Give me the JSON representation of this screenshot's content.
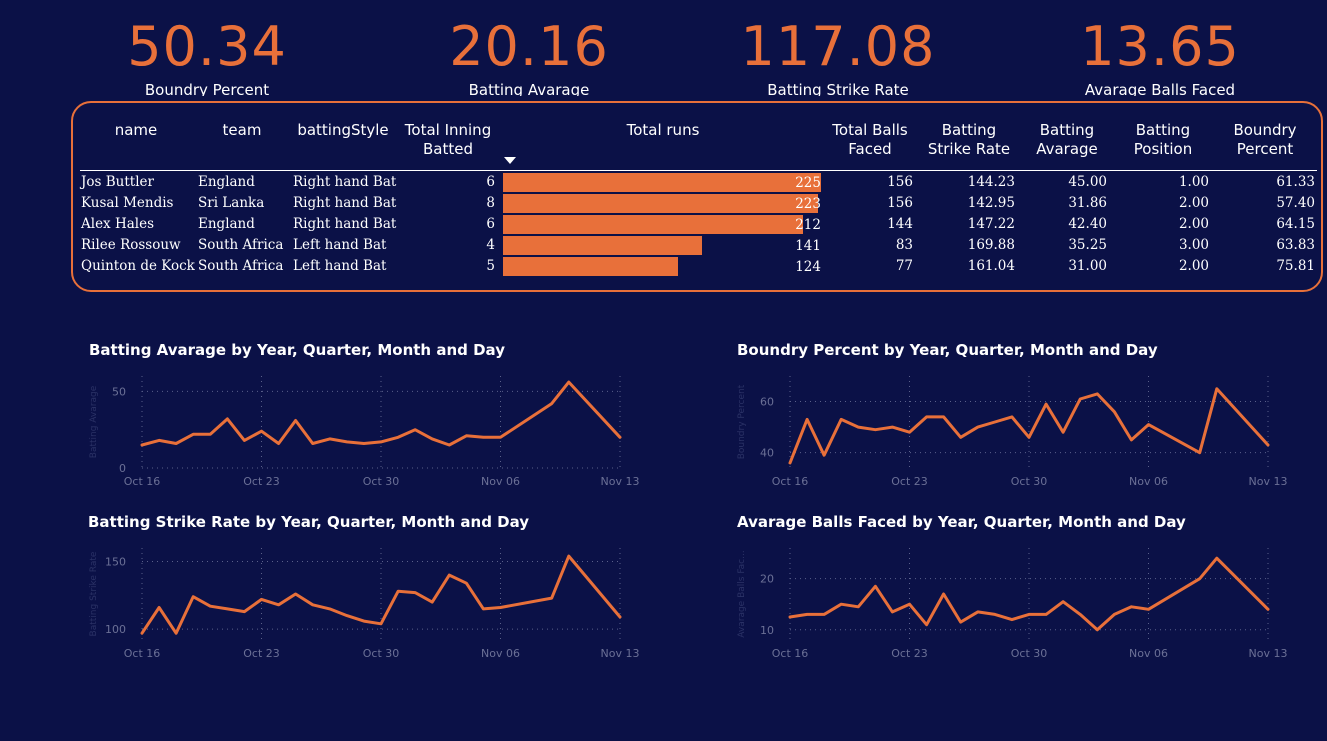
{
  "kpis": [
    {
      "value": "50.34",
      "label": "Boundry Percent"
    },
    {
      "value": "20.16",
      "label": "Batting Avarage"
    },
    {
      "value": "117.08",
      "label": "Batting Strike Rate"
    },
    {
      "value": "13.65",
      "label": "Avarage Balls Faced"
    }
  ],
  "table": {
    "headers": [
      "name",
      "team",
      "battingStyle",
      "Total Inning Batted",
      "Total runs",
      "Total Balls Faced",
      "Batting Strike Rate",
      "Batting Avarage",
      "Batting Position",
      "Boundry Percent"
    ],
    "rows": [
      {
        "name": "Jos Buttler",
        "team": "England",
        "style": "Right hand Bat",
        "innings": "6",
        "runs": 225,
        "balls": "156",
        "sr": "144.23",
        "avg": "45.00",
        "pos": "1.00",
        "bp": "61.33"
      },
      {
        "name": "Kusal Mendis",
        "team": "Sri Lanka",
        "style": "Right hand Bat",
        "innings": "8",
        "runs": 223,
        "balls": "156",
        "sr": "142.95",
        "avg": "31.86",
        "pos": "2.00",
        "bp": "57.40"
      },
      {
        "name": "Alex Hales",
        "team": "England",
        "style": "Right hand Bat",
        "innings": "6",
        "runs": 212,
        "balls": "144",
        "sr": "147.22",
        "avg": "42.40",
        "pos": "2.00",
        "bp": "64.15"
      },
      {
        "name": "Rilee Rossouw",
        "team": "South Africa",
        "style": "Left hand Bat",
        "innings": "4",
        "runs": 141,
        "balls": "83",
        "sr": "169.88",
        "avg": "35.25",
        "pos": "3.00",
        "bp": "63.83"
      },
      {
        "name": "Quinton de Kock",
        "team": "South Africa",
        "style": "Left hand Bat",
        "innings": "5",
        "runs": 124,
        "balls": "77",
        "sr": "161.04",
        "avg": "31.00",
        "pos": "2.00",
        "bp": "75.81"
      }
    ]
  },
  "chart_data": [
    {
      "type": "line",
      "title": "Batting Avarage by Year, Quarter, Month and Day",
      "ylabel": "Batting Avarage",
      "x": [
        "Oct 16",
        "Oct 17",
        "Oct 18",
        "Oct 19",
        "Oct 20",
        "Oct 21",
        "Oct 22",
        "Oct 23",
        "Oct 24",
        "Oct 25",
        "Oct 26",
        "Oct 27",
        "Oct 28",
        "Oct 29",
        "Oct 30",
        "Oct 31",
        "Nov 01",
        "Nov 02",
        "Nov 03",
        "Nov 04",
        "Nov 05",
        "Nov 06",
        "Nov 09",
        "Nov 10",
        "Nov 13"
      ],
      "values": [
        15,
        18,
        16,
        22,
        22,
        32,
        18,
        24,
        16,
        31,
        16,
        19,
        17,
        16,
        17,
        20,
        25,
        19,
        15,
        21,
        20,
        20,
        42,
        56,
        20
      ],
      "xticks": [
        "Oct 16",
        "Oct 23",
        "Oct 30",
        "Nov 06",
        "Nov 13"
      ],
      "yticks": [
        0,
        50
      ],
      "ylim": [
        0,
        60
      ],
      "color": "#e8703a"
    },
    {
      "type": "line",
      "title": "Boundry Percent by Year, Quarter, Month and Day",
      "ylabel": "Boundry Percent",
      "x": [
        "Oct 16",
        "Oct 17",
        "Oct 18",
        "Oct 19",
        "Oct 20",
        "Oct 21",
        "Oct 22",
        "Oct 23",
        "Oct 24",
        "Oct 25",
        "Oct 26",
        "Oct 27",
        "Oct 28",
        "Oct 29",
        "Oct 30",
        "Oct 31",
        "Nov 01",
        "Nov 02",
        "Nov 03",
        "Nov 04",
        "Nov 05",
        "Nov 06",
        "Nov 09",
        "Nov 10",
        "Nov 13"
      ],
      "values": [
        36,
        53,
        39,
        53,
        50,
        49,
        50,
        48,
        54,
        54,
        46,
        50,
        52,
        54,
        46,
        59,
        48,
        61,
        63,
        56,
        45,
        51,
        40,
        65,
        43
      ],
      "xticks": [
        "Oct 16",
        "Oct 23",
        "Oct 30",
        "Nov 06",
        "Nov 13"
      ],
      "yticks": [
        40,
        60
      ],
      "ylim": [
        34,
        70
      ],
      "color": "#e8703a"
    },
    {
      "type": "line",
      "title": "Batting Strike Rate by Year, Quarter, Month and Day",
      "ylabel": "Batting Strike Rate",
      "x": [
        "Oct 16",
        "Oct 17",
        "Oct 18",
        "Oct 19",
        "Oct 20",
        "Oct 21",
        "Oct 22",
        "Oct 23",
        "Oct 24",
        "Oct 25",
        "Oct 26",
        "Oct 27",
        "Oct 28",
        "Oct 29",
        "Oct 30",
        "Oct 31",
        "Nov 01",
        "Nov 02",
        "Nov 03",
        "Nov 04",
        "Nov 05",
        "Nov 06",
        "Nov 09",
        "Nov 10",
        "Nov 13"
      ],
      "values": [
        97,
        116,
        97,
        124,
        117,
        115,
        113,
        122,
        118,
        126,
        118,
        115,
        110,
        106,
        104,
        128,
        127,
        120,
        140,
        134,
        115,
        116,
        123,
        154,
        109
      ],
      "xticks": [
        "Oct 16",
        "Oct 23",
        "Oct 30",
        "Nov 06",
        "Nov 13"
      ],
      "yticks": [
        100,
        150
      ],
      "ylim": [
        92,
        160
      ],
      "color": "#e8703a"
    },
    {
      "type": "line",
      "title": "Avarage Balls Faced by Year, Quarter, Month and Day",
      "ylabel": "Avarage Balls Fac...",
      "x": [
        "Oct 16",
        "Oct 17",
        "Oct 18",
        "Oct 19",
        "Oct 20",
        "Oct 21",
        "Oct 22",
        "Oct 23",
        "Oct 24",
        "Oct 25",
        "Oct 26",
        "Oct 27",
        "Oct 28",
        "Oct 29",
        "Oct 30",
        "Oct 31",
        "Nov 01",
        "Nov 02",
        "Nov 03",
        "Nov 04",
        "Nov 05",
        "Nov 06",
        "Nov 09",
        "Nov 10",
        "Nov 13"
      ],
      "values": [
        12.5,
        13,
        13,
        15,
        14.5,
        18.5,
        13.5,
        15,
        11,
        17,
        11.5,
        13.5,
        13,
        12,
        13,
        13,
        15.5,
        13,
        10,
        13,
        14.5,
        14,
        20,
        24,
        14
      ],
      "xticks": [
        "Oct 16",
        "Oct 23",
        "Oct 30",
        "Nov 06",
        "Nov 13"
      ],
      "yticks": [
        10,
        20
      ],
      "ylim": [
        8,
        26
      ],
      "color": "#e8703a"
    }
  ]
}
